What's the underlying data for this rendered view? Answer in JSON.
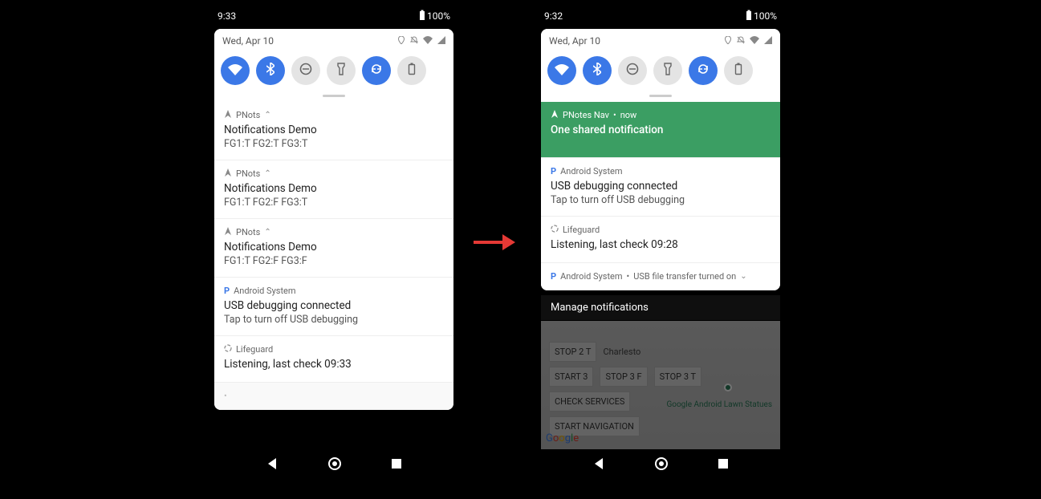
{
  "left": {
    "status": {
      "time": "9:33",
      "battery": "100%"
    },
    "qs": {
      "date": "Wed, Apr 10"
    },
    "toggles": [
      {
        "name": "wifi",
        "on": true,
        "glyph": "wifi"
      },
      {
        "name": "bluetooth",
        "on": true,
        "glyph": "bt"
      },
      {
        "name": "dnd",
        "on": false,
        "glyph": "dnd"
      },
      {
        "name": "flashlight",
        "on": false,
        "glyph": "flash"
      },
      {
        "name": "rotate",
        "on": true,
        "glyph": "rotate"
      },
      {
        "name": "battery",
        "on": false,
        "glyph": "batt"
      }
    ],
    "notifications": [
      {
        "app": "PNots",
        "title": "Notifications Demo",
        "body": "FG1:T FG2:T FG3:T",
        "collapsible": true
      },
      {
        "app": "PNots",
        "title": "Notifications Demo",
        "body": "FG1:T FG2:F FG3:T",
        "collapsible": true
      },
      {
        "app": "PNots",
        "title": "Notifications Demo",
        "body": "FG1:T FG2:F FG3:F",
        "collapsible": true
      },
      {
        "app": "Android System",
        "title": "USB debugging connected",
        "body": "Tap to turn off USB debugging"
      },
      {
        "app": "Lifeguard",
        "title": "Listening, last check 09:33",
        "body": ""
      }
    ]
  },
  "right": {
    "status": {
      "time": "9:32",
      "battery": "100%"
    },
    "qs": {
      "date": "Wed, Apr 10"
    },
    "toggles": [
      {
        "name": "wifi",
        "on": true,
        "glyph": "wifi"
      },
      {
        "name": "bluetooth",
        "on": true,
        "glyph": "bt"
      },
      {
        "name": "dnd",
        "on": false,
        "glyph": "dnd"
      },
      {
        "name": "flashlight",
        "on": false,
        "glyph": "flash"
      },
      {
        "name": "rotate",
        "on": true,
        "glyph": "rotate"
      },
      {
        "name": "battery",
        "on": false,
        "glyph": "batt"
      }
    ],
    "featured": {
      "app": "PNotes Nav",
      "when": "now",
      "title": "One shared notification"
    },
    "notifications": [
      {
        "app": "Android System",
        "title": "USB debugging connected",
        "body": "Tap to turn off USB debugging"
      },
      {
        "app": "Lifeguard",
        "title": "Listening, last check 09:28",
        "body": ""
      }
    ],
    "collapsed": {
      "app": "Android System",
      "summary": "USB file transfer turned on"
    },
    "manage": "Manage notifications",
    "map_buttons": {
      "row1": [
        "STOP 2 T"
      ],
      "row2": [
        "START 3",
        "STOP 3 F",
        "STOP 3 T"
      ],
      "row3": [
        "CHECK SERVICES"
      ],
      "row4": [
        "START NAVIGATION"
      ]
    },
    "map_labels": {
      "poi": "Google Android\nLawn Statues",
      "charlesto": "Charlesto"
    }
  }
}
